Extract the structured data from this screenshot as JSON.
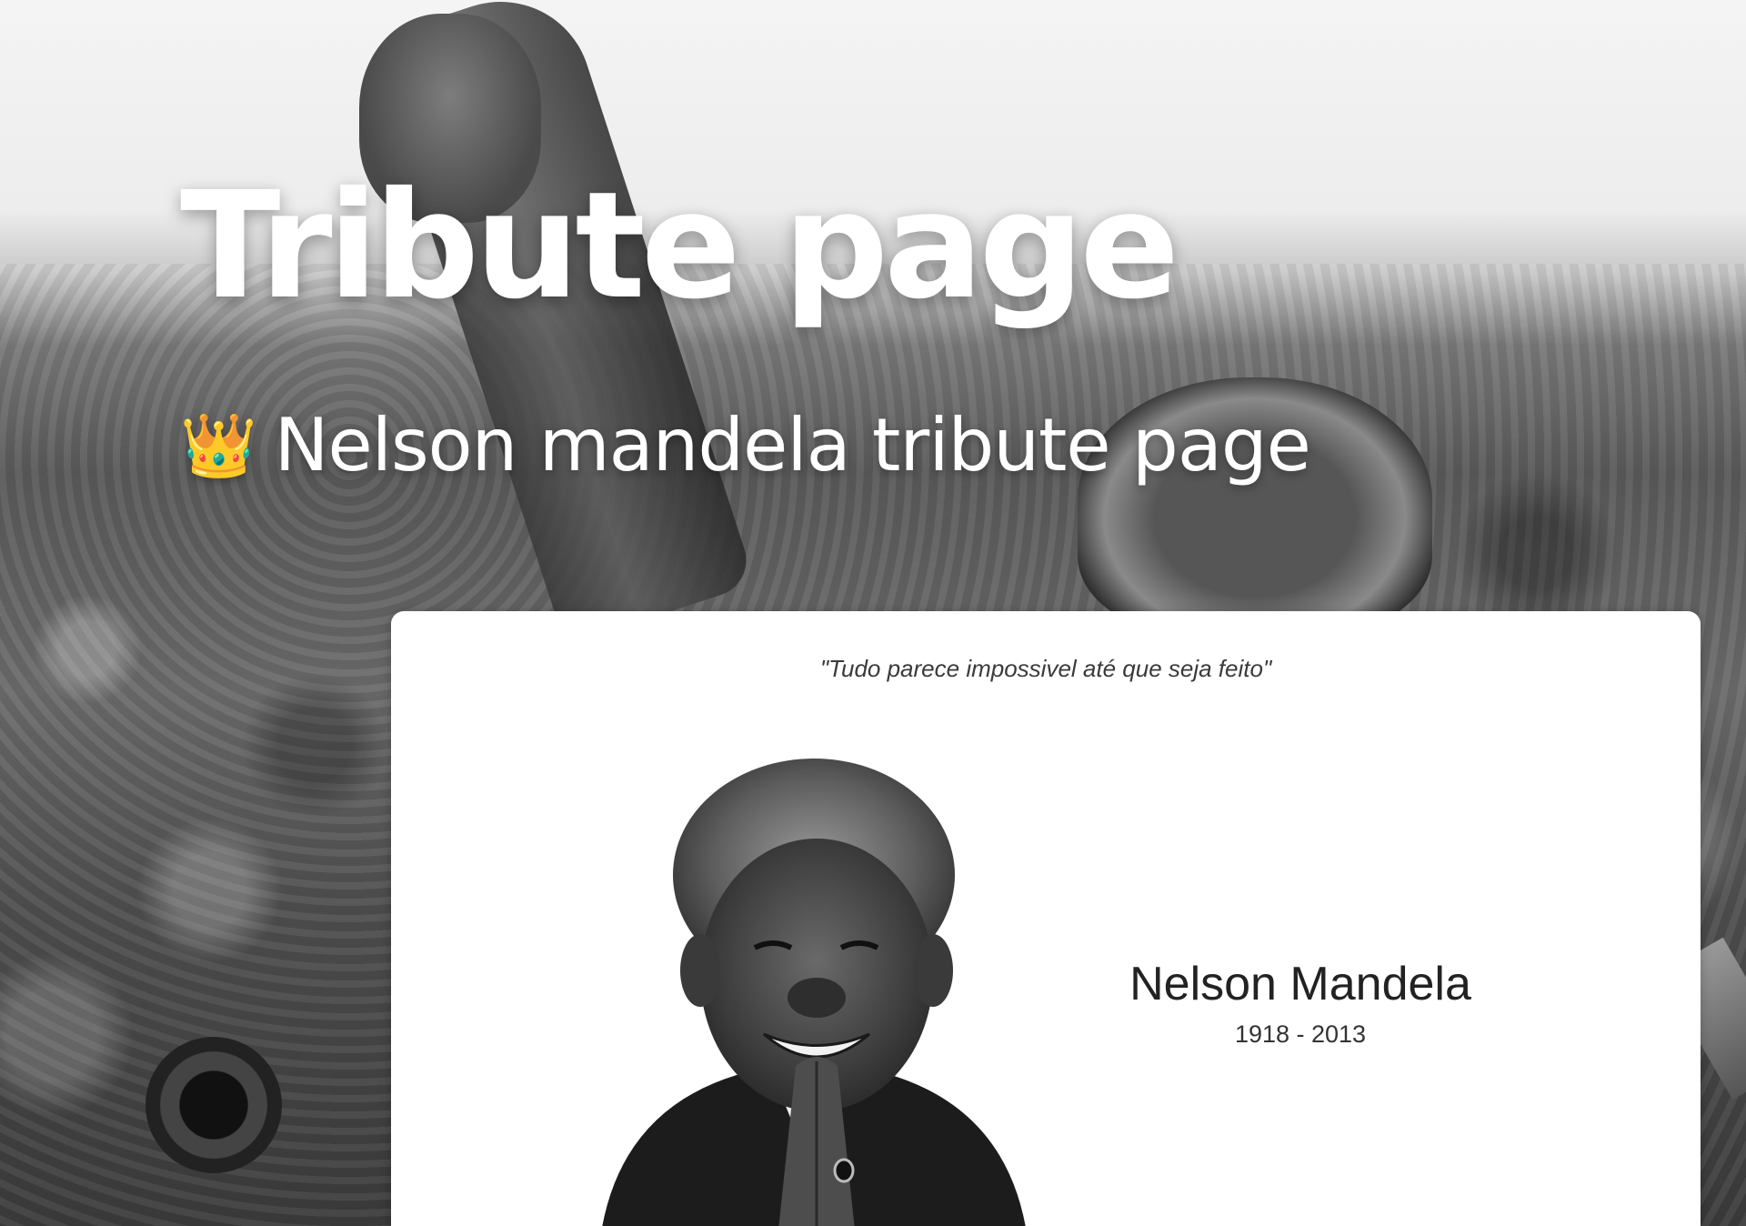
{
  "header": {
    "title": "Tribute page",
    "subtitle_icon": "crown-icon",
    "subtitle_emoji": "👑",
    "subtitle": "Nelson mandela tribute page"
  },
  "card": {
    "quote": "\"Tudo parece impossivel até que seja feito\"",
    "name": "Nelson Mandela",
    "dates": "1918 - 2013"
  },
  "colors": {
    "title_text": "#ffffff",
    "card_background": "#ffffff",
    "card_text": "#222222"
  }
}
